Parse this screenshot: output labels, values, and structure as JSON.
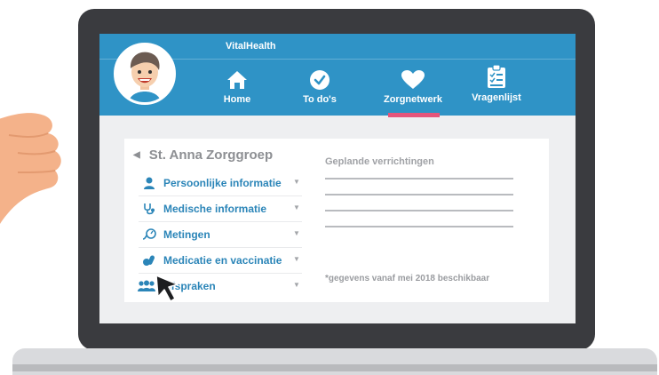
{
  "app": {
    "brand": "VitalHealth"
  },
  "nav": {
    "items": [
      {
        "label": "Home",
        "icon": "home-icon"
      },
      {
        "label": "To do's",
        "icon": "check-circle-icon"
      },
      {
        "label": "Zorgnetwerk",
        "icon": "heart-icon",
        "active": true
      },
      {
        "label": "Vragenlijst",
        "icon": "clipboard-icon"
      }
    ],
    "active_color": "#e5557b"
  },
  "panel": {
    "back_label": "St. Anna Zorggroep",
    "menu": [
      {
        "label": "Persoonlijke informatie",
        "icon": "person-icon"
      },
      {
        "label": "Medische informatie",
        "icon": "stethoscope-icon"
      },
      {
        "label": "Metingen",
        "icon": "meter-icon"
      },
      {
        "label": "Medicatie en vaccinatie",
        "icon": "pills-icon"
      },
      {
        "label": "Afspraken",
        "icon": "people-icon"
      }
    ],
    "side_title": "Geplande verrichtingen",
    "footnote": "*gegevens vanaf mei 2018 beschikbaar"
  },
  "colors": {
    "primary": "#2f93c6",
    "link": "#2b85b8",
    "accent": "#e5557b"
  }
}
